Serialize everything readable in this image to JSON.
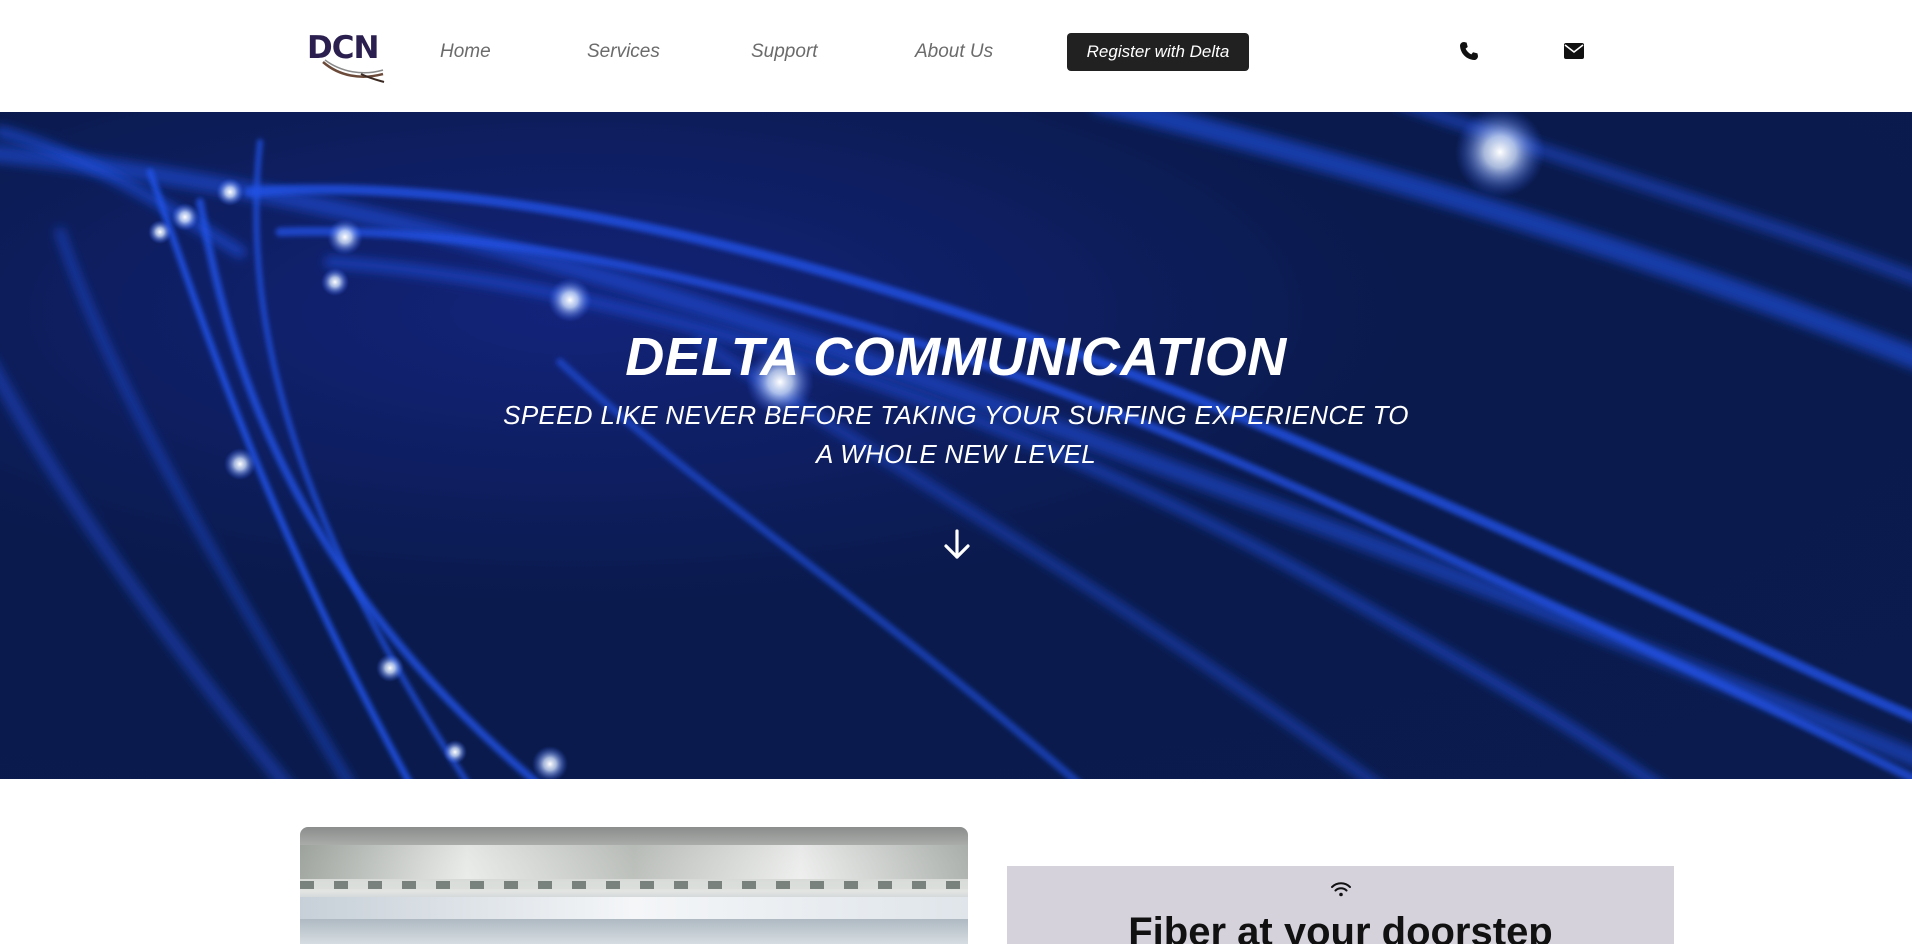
{
  "header": {
    "logo_text": "DCN",
    "nav": {
      "home": "Home",
      "services": "Services",
      "support": "Support",
      "about": "About Us"
    },
    "register_label": "Register with Delta",
    "icons": [
      "phone-icon",
      "envelope-icon"
    ]
  },
  "hero": {
    "title": "DELTA COMMUNICATION",
    "subtitle": "SPEED LIKE NEVER BEFORE TAKING YOUR SURFING EXPERIENCE TO A WHOLE NEW LEVEL",
    "scroll_icon": "arrow-down-icon"
  },
  "feature": {
    "icon": "wifi-icon",
    "title": "Fiber at your doorstep"
  },
  "colors": {
    "hero_bg": "#0b1b4d",
    "fiber_blue": "#1f52e6",
    "button_bg": "#212121",
    "feature_card_bg": "#d6d2dc"
  }
}
